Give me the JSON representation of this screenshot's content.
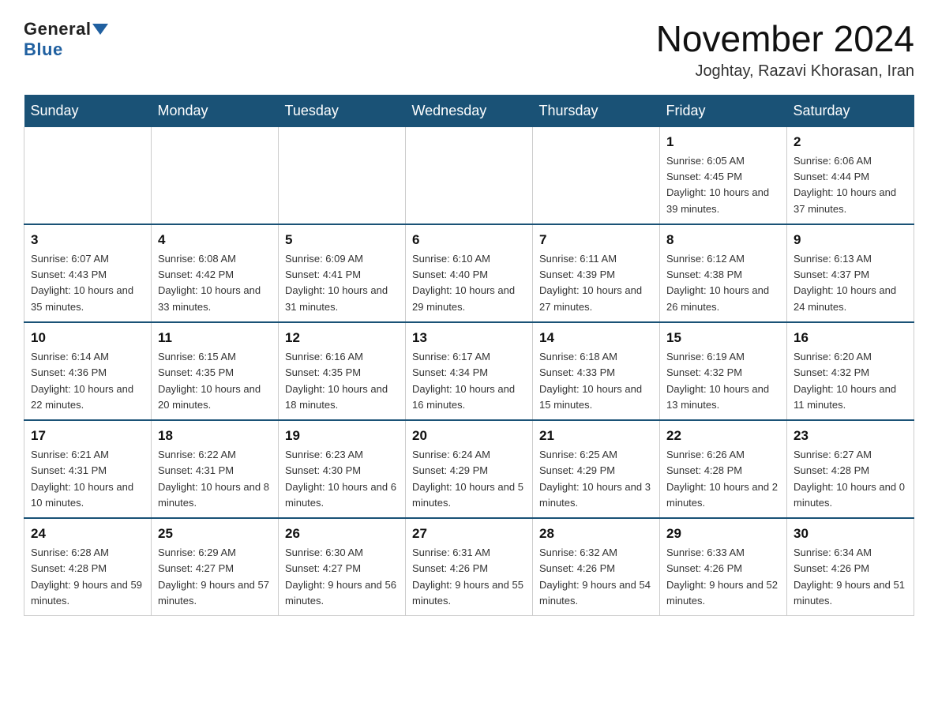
{
  "header": {
    "logo_general": "General",
    "logo_blue": "Blue",
    "month_title": "November 2024",
    "location": "Joghtay, Razavi Khorasan, Iran"
  },
  "days_of_week": [
    "Sunday",
    "Monday",
    "Tuesday",
    "Wednesday",
    "Thursday",
    "Friday",
    "Saturday"
  ],
  "weeks": [
    [
      {
        "day": "",
        "sunrise": "",
        "sunset": "",
        "daylight": ""
      },
      {
        "day": "",
        "sunrise": "",
        "sunset": "",
        "daylight": ""
      },
      {
        "day": "",
        "sunrise": "",
        "sunset": "",
        "daylight": ""
      },
      {
        "day": "",
        "sunrise": "",
        "sunset": "",
        "daylight": ""
      },
      {
        "day": "",
        "sunrise": "",
        "sunset": "",
        "daylight": ""
      },
      {
        "day": "1",
        "sunrise": "Sunrise: 6:05 AM",
        "sunset": "Sunset: 4:45 PM",
        "daylight": "Daylight: 10 hours and 39 minutes."
      },
      {
        "day": "2",
        "sunrise": "Sunrise: 6:06 AM",
        "sunset": "Sunset: 4:44 PM",
        "daylight": "Daylight: 10 hours and 37 minutes."
      }
    ],
    [
      {
        "day": "3",
        "sunrise": "Sunrise: 6:07 AM",
        "sunset": "Sunset: 4:43 PM",
        "daylight": "Daylight: 10 hours and 35 minutes."
      },
      {
        "day": "4",
        "sunrise": "Sunrise: 6:08 AM",
        "sunset": "Sunset: 4:42 PM",
        "daylight": "Daylight: 10 hours and 33 minutes."
      },
      {
        "day": "5",
        "sunrise": "Sunrise: 6:09 AM",
        "sunset": "Sunset: 4:41 PM",
        "daylight": "Daylight: 10 hours and 31 minutes."
      },
      {
        "day": "6",
        "sunrise": "Sunrise: 6:10 AM",
        "sunset": "Sunset: 4:40 PM",
        "daylight": "Daylight: 10 hours and 29 minutes."
      },
      {
        "day": "7",
        "sunrise": "Sunrise: 6:11 AM",
        "sunset": "Sunset: 4:39 PM",
        "daylight": "Daylight: 10 hours and 27 minutes."
      },
      {
        "day": "8",
        "sunrise": "Sunrise: 6:12 AM",
        "sunset": "Sunset: 4:38 PM",
        "daylight": "Daylight: 10 hours and 26 minutes."
      },
      {
        "day": "9",
        "sunrise": "Sunrise: 6:13 AM",
        "sunset": "Sunset: 4:37 PM",
        "daylight": "Daylight: 10 hours and 24 minutes."
      }
    ],
    [
      {
        "day": "10",
        "sunrise": "Sunrise: 6:14 AM",
        "sunset": "Sunset: 4:36 PM",
        "daylight": "Daylight: 10 hours and 22 minutes."
      },
      {
        "day": "11",
        "sunrise": "Sunrise: 6:15 AM",
        "sunset": "Sunset: 4:35 PM",
        "daylight": "Daylight: 10 hours and 20 minutes."
      },
      {
        "day": "12",
        "sunrise": "Sunrise: 6:16 AM",
        "sunset": "Sunset: 4:35 PM",
        "daylight": "Daylight: 10 hours and 18 minutes."
      },
      {
        "day": "13",
        "sunrise": "Sunrise: 6:17 AM",
        "sunset": "Sunset: 4:34 PM",
        "daylight": "Daylight: 10 hours and 16 minutes."
      },
      {
        "day": "14",
        "sunrise": "Sunrise: 6:18 AM",
        "sunset": "Sunset: 4:33 PM",
        "daylight": "Daylight: 10 hours and 15 minutes."
      },
      {
        "day": "15",
        "sunrise": "Sunrise: 6:19 AM",
        "sunset": "Sunset: 4:32 PM",
        "daylight": "Daylight: 10 hours and 13 minutes."
      },
      {
        "day": "16",
        "sunrise": "Sunrise: 6:20 AM",
        "sunset": "Sunset: 4:32 PM",
        "daylight": "Daylight: 10 hours and 11 minutes."
      }
    ],
    [
      {
        "day": "17",
        "sunrise": "Sunrise: 6:21 AM",
        "sunset": "Sunset: 4:31 PM",
        "daylight": "Daylight: 10 hours and 10 minutes."
      },
      {
        "day": "18",
        "sunrise": "Sunrise: 6:22 AM",
        "sunset": "Sunset: 4:31 PM",
        "daylight": "Daylight: 10 hours and 8 minutes."
      },
      {
        "day": "19",
        "sunrise": "Sunrise: 6:23 AM",
        "sunset": "Sunset: 4:30 PM",
        "daylight": "Daylight: 10 hours and 6 minutes."
      },
      {
        "day": "20",
        "sunrise": "Sunrise: 6:24 AM",
        "sunset": "Sunset: 4:29 PM",
        "daylight": "Daylight: 10 hours and 5 minutes."
      },
      {
        "day": "21",
        "sunrise": "Sunrise: 6:25 AM",
        "sunset": "Sunset: 4:29 PM",
        "daylight": "Daylight: 10 hours and 3 minutes."
      },
      {
        "day": "22",
        "sunrise": "Sunrise: 6:26 AM",
        "sunset": "Sunset: 4:28 PM",
        "daylight": "Daylight: 10 hours and 2 minutes."
      },
      {
        "day": "23",
        "sunrise": "Sunrise: 6:27 AM",
        "sunset": "Sunset: 4:28 PM",
        "daylight": "Daylight: 10 hours and 0 minutes."
      }
    ],
    [
      {
        "day": "24",
        "sunrise": "Sunrise: 6:28 AM",
        "sunset": "Sunset: 4:28 PM",
        "daylight": "Daylight: 9 hours and 59 minutes."
      },
      {
        "day": "25",
        "sunrise": "Sunrise: 6:29 AM",
        "sunset": "Sunset: 4:27 PM",
        "daylight": "Daylight: 9 hours and 57 minutes."
      },
      {
        "day": "26",
        "sunrise": "Sunrise: 6:30 AM",
        "sunset": "Sunset: 4:27 PM",
        "daylight": "Daylight: 9 hours and 56 minutes."
      },
      {
        "day": "27",
        "sunrise": "Sunrise: 6:31 AM",
        "sunset": "Sunset: 4:26 PM",
        "daylight": "Daylight: 9 hours and 55 minutes."
      },
      {
        "day": "28",
        "sunrise": "Sunrise: 6:32 AM",
        "sunset": "Sunset: 4:26 PM",
        "daylight": "Daylight: 9 hours and 54 minutes."
      },
      {
        "day": "29",
        "sunrise": "Sunrise: 6:33 AM",
        "sunset": "Sunset: 4:26 PM",
        "daylight": "Daylight: 9 hours and 52 minutes."
      },
      {
        "day": "30",
        "sunrise": "Sunrise: 6:34 AM",
        "sunset": "Sunset: 4:26 PM",
        "daylight": "Daylight: 9 hours and 51 minutes."
      }
    ]
  ]
}
